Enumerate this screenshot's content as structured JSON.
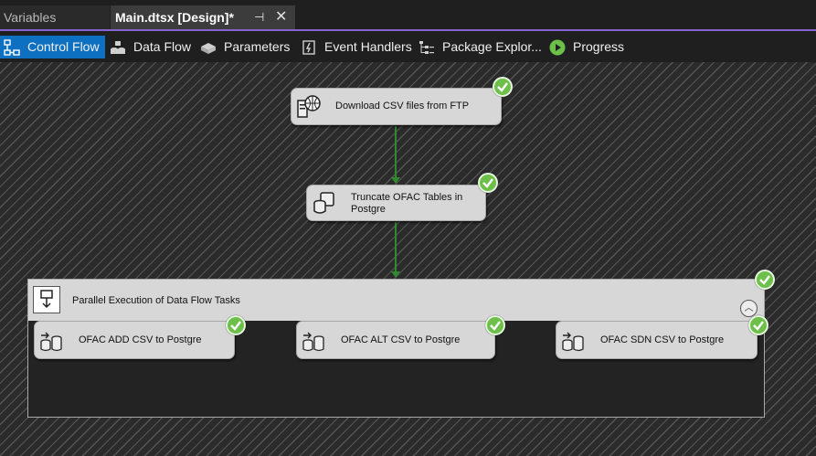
{
  "tabs": [
    {
      "label": "Variables"
    },
    {
      "label": "Main.dtsx [Design]*"
    }
  ],
  "designer_tabs": [
    {
      "label": "Control Flow",
      "icon": "control-flow-icon"
    },
    {
      "label": "Data Flow",
      "icon": "data-flow-icon"
    },
    {
      "label": "Parameters",
      "icon": "parameters-icon"
    },
    {
      "label": "Event Handlers",
      "icon": "event-handlers-icon"
    },
    {
      "label": "Package Explor...",
      "icon": "package-explorer-icon"
    },
    {
      "label": "Progress",
      "icon": "progress-icon"
    }
  ],
  "tasks": {
    "download": "Download CSV files from FTP",
    "truncate": "Truncate OFAC Tables in Postgre"
  },
  "container": {
    "title": "Parallel Execution of Data Flow Tasks",
    "children": [
      "OFAC ADD CSV to Postgre",
      "OFAC ALT CSV to Postgre",
      "OFAC SDN CSV to Postgre"
    ]
  },
  "colors": {
    "accent": "#0e70c0",
    "success": "#6cc04a",
    "tab_underline": "#8a63d2",
    "connector": "#2e8b2e"
  }
}
